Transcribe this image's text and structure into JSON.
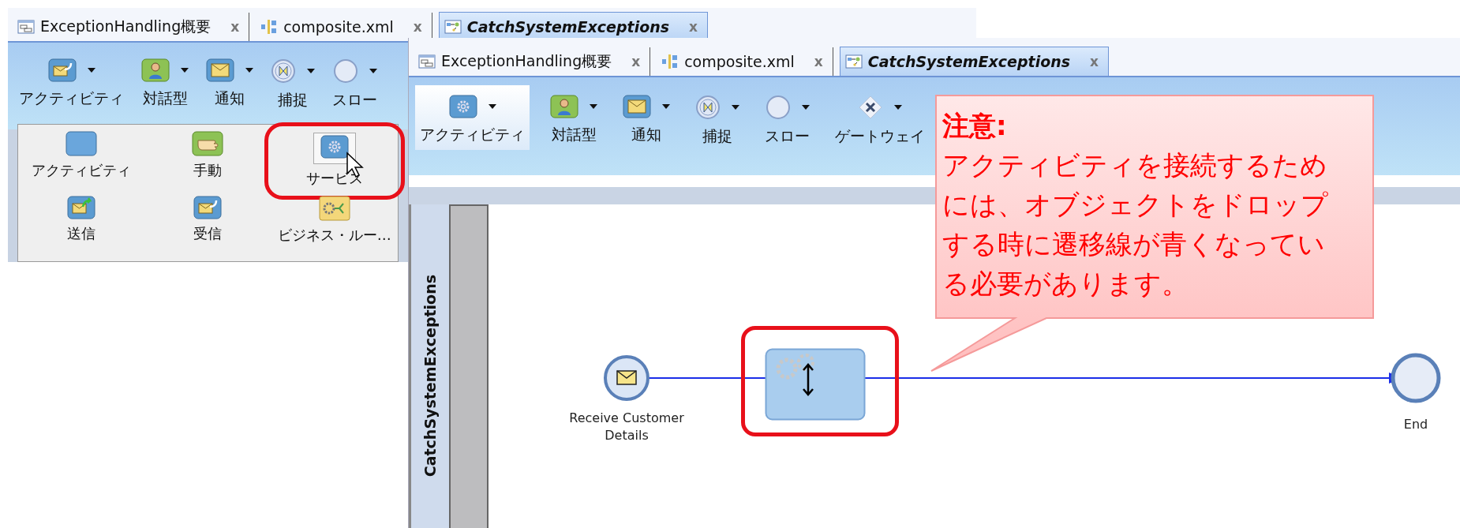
{
  "back_window": {
    "tabs": [
      {
        "label": "ExceptionHandling概要",
        "kind": "overview",
        "close": "x",
        "selected": false
      },
      {
        "label": "composite.xml",
        "kind": "composite",
        "close": "x",
        "selected": false
      },
      {
        "label": "CatchSystemExceptions",
        "kind": "process",
        "close": "x",
        "selected": true
      }
    ],
    "toolbar": [
      {
        "label": "アクティビティ",
        "kind": "receive",
        "selected": false
      },
      {
        "label": "対話型",
        "kind": "interactive",
        "selected": false
      },
      {
        "label": "通知",
        "kind": "notify",
        "selected": false
      },
      {
        "label": "捕捉",
        "kind": "catch",
        "selected": false
      },
      {
        "label": "スロー",
        "kind": "throw",
        "selected": false
      }
    ],
    "palette": [
      {
        "label": "アクティビティ",
        "kind": "activity",
        "selected": false
      },
      {
        "label": "手動",
        "kind": "manual",
        "selected": false
      },
      {
        "label": "サービス",
        "kind": "service",
        "selected": true
      },
      {
        "label": "送信",
        "kind": "send",
        "selected": false
      },
      {
        "label": "受信",
        "kind": "receive",
        "selected": false
      },
      {
        "label": "ビジネス・ルー…",
        "kind": "rule",
        "selected": false
      }
    ]
  },
  "front_window": {
    "tabs": [
      {
        "label": "ExceptionHandling概要",
        "kind": "overview",
        "close": "x",
        "selected": false
      },
      {
        "label": "composite.xml",
        "kind": "composite",
        "close": "x",
        "selected": false
      },
      {
        "label": "CatchSystemExceptions",
        "kind": "process",
        "close": "x",
        "selected": true
      }
    ],
    "toolbar": [
      {
        "label": "アクティビティ",
        "kind": "service",
        "selected": true
      },
      {
        "label": "対話型",
        "kind": "interactive",
        "selected": false
      },
      {
        "label": "通知",
        "kind": "notify",
        "selected": false
      },
      {
        "label": "捕捉",
        "kind": "catch",
        "selected": false
      },
      {
        "label": "スロー",
        "kind": "throw",
        "selected": false
      },
      {
        "label": "ゲートウェイ",
        "kind": "gateway",
        "selected": false
      }
    ],
    "swimlane": {
      "title": "CatchSystemExceptions"
    },
    "nodes": [
      {
        "kind": "message_start",
        "label": "Receive Customer Details"
      },
      {
        "kind": "service",
        "highlighted": true
      },
      {
        "kind": "end",
        "label": "End"
      }
    ]
  },
  "callout": {
    "title": "注意:",
    "text": "アクティビティを接続するためには、オブジェクトをドロップする時に遷移線が青くなっている必要があります。"
  }
}
